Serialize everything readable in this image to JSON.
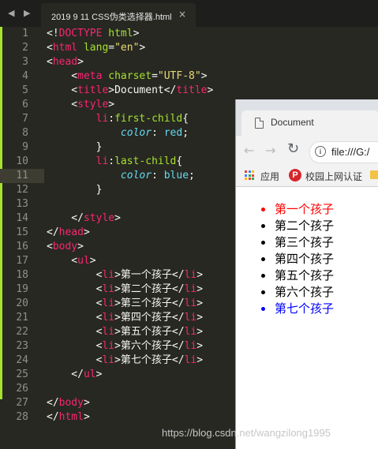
{
  "editor": {
    "tab_title": "2019 9 11 CSS伪类选择器.html",
    "nav_arrows": "◀ ▶",
    "close_glyph": "×",
    "active_line": 11
  },
  "code_lines": [
    {
      "n": "1",
      "tokens": [
        [
          "tx",
          "<!"
        ],
        [
          "tg",
          "DOCTYPE"
        ],
        [
          "tx",
          " "
        ],
        [
          "at",
          "html"
        ],
        [
          "tx",
          ">"
        ]
      ]
    },
    {
      "n": "2",
      "tokens": [
        [
          "tx",
          "<"
        ],
        [
          "tg",
          "html"
        ],
        [
          "tx",
          " "
        ],
        [
          "at",
          "lang"
        ],
        [
          "tx",
          "="
        ],
        [
          "st",
          "\"en\""
        ],
        [
          "tx",
          ">"
        ]
      ]
    },
    {
      "n": "3",
      "tokens": [
        [
          "tx",
          "<"
        ],
        [
          "tg",
          "head"
        ],
        [
          "tx",
          ">"
        ]
      ]
    },
    {
      "n": "4",
      "tokens": [
        [
          "tx",
          "    <"
        ],
        [
          "tg",
          "meta"
        ],
        [
          "tx",
          " "
        ],
        [
          "at",
          "charset"
        ],
        [
          "tx",
          "="
        ],
        [
          "st",
          "\"UTF-8\""
        ],
        [
          "tx",
          ">"
        ]
      ]
    },
    {
      "n": "5",
      "tokens": [
        [
          "tx",
          "    <"
        ],
        [
          "tg",
          "title"
        ],
        [
          "tx",
          ">Document</"
        ],
        [
          "tg",
          "title"
        ],
        [
          "tx",
          ">"
        ]
      ]
    },
    {
      "n": "6",
      "tokens": [
        [
          "tx",
          "    <"
        ],
        [
          "tg",
          "style"
        ],
        [
          "tx",
          ">"
        ]
      ]
    },
    {
      "n": "7",
      "tokens": [
        [
          "tx",
          "        "
        ],
        [
          "tg",
          "li"
        ],
        [
          "tx",
          ":"
        ],
        [
          "at",
          "first-child"
        ],
        [
          "tx",
          "{"
        ]
      ]
    },
    {
      "n": "8",
      "tokens": [
        [
          "tx",
          "            "
        ],
        [
          "kw",
          "color"
        ],
        [
          "tx",
          ": "
        ],
        [
          "vl",
          "red"
        ],
        [
          "tx",
          ";"
        ]
      ]
    },
    {
      "n": "9",
      "tokens": [
        [
          "tx",
          "        }"
        ]
      ]
    },
    {
      "n": "10",
      "tokens": [
        [
          "tx",
          "        "
        ],
        [
          "tg",
          "li"
        ],
        [
          "tx",
          ":"
        ],
        [
          "at",
          "last-child"
        ],
        [
          "tx",
          "{"
        ]
      ]
    },
    {
      "n": "11",
      "tokens": [
        [
          "tx",
          "            "
        ],
        [
          "kw",
          "color"
        ],
        [
          "tx",
          ": "
        ],
        [
          "vl",
          "blue"
        ],
        [
          "tx",
          ";"
        ]
      ]
    },
    {
      "n": "12",
      "tokens": [
        [
          "tx",
          "        }"
        ]
      ]
    },
    {
      "n": "13",
      "tokens": []
    },
    {
      "n": "14",
      "tokens": [
        [
          "tx",
          "    </"
        ],
        [
          "tg",
          "style"
        ],
        [
          "tx",
          ">"
        ]
      ]
    },
    {
      "n": "15",
      "tokens": [
        [
          "tx",
          "</"
        ],
        [
          "tg",
          "head"
        ],
        [
          "tx",
          ">"
        ]
      ]
    },
    {
      "n": "16",
      "tokens": [
        [
          "tx",
          "<"
        ],
        [
          "tg",
          "body"
        ],
        [
          "tx",
          ">"
        ]
      ]
    },
    {
      "n": "17",
      "tokens": [
        [
          "tx",
          "    <"
        ],
        [
          "tg",
          "ul"
        ],
        [
          "tx",
          ">"
        ]
      ]
    },
    {
      "n": "18",
      "tokens": [
        [
          "tx",
          "        <"
        ],
        [
          "tg",
          "li"
        ],
        [
          "tx",
          ">第一个孩子</"
        ],
        [
          "tg",
          "li"
        ],
        [
          "tx",
          ">"
        ]
      ]
    },
    {
      "n": "19",
      "tokens": [
        [
          "tx",
          "        <"
        ],
        [
          "tg",
          "li"
        ],
        [
          "tx",
          ">第二个孩子</"
        ],
        [
          "tg",
          "li"
        ],
        [
          "tx",
          ">"
        ]
      ]
    },
    {
      "n": "20",
      "tokens": [
        [
          "tx",
          "        <"
        ],
        [
          "tg",
          "li"
        ],
        [
          "tx",
          ">第三个孩子</"
        ],
        [
          "tg",
          "li"
        ],
        [
          "tx",
          ">"
        ]
      ]
    },
    {
      "n": "21",
      "tokens": [
        [
          "tx",
          "        <"
        ],
        [
          "tg",
          "li"
        ],
        [
          "tx",
          ">第四个孩子</"
        ],
        [
          "tg",
          "li"
        ],
        [
          "tx",
          ">"
        ]
      ]
    },
    {
      "n": "22",
      "tokens": [
        [
          "tx",
          "        <"
        ],
        [
          "tg",
          "li"
        ],
        [
          "tx",
          ">第五个孩子</"
        ],
        [
          "tg",
          "li"
        ],
        [
          "tx",
          ">"
        ]
      ]
    },
    {
      "n": "23",
      "tokens": [
        [
          "tx",
          "        <"
        ],
        [
          "tg",
          "li"
        ],
        [
          "tx",
          ">第六个孩子</"
        ],
        [
          "tg",
          "li"
        ],
        [
          "tx",
          ">"
        ]
      ]
    },
    {
      "n": "24",
      "tokens": [
        [
          "tx",
          "        <"
        ],
        [
          "tg",
          "li"
        ],
        [
          "tx",
          ">第七个孩子</"
        ],
        [
          "tg",
          "li"
        ],
        [
          "tx",
          ">"
        ]
      ]
    },
    {
      "n": "25",
      "tokens": [
        [
          "tx",
          "    </"
        ],
        [
          "tg",
          "ul"
        ],
        [
          "tx",
          ">"
        ]
      ]
    },
    {
      "n": "26",
      "tokens": []
    },
    {
      "n": "27",
      "tokens": [
        [
          "tx",
          "</"
        ],
        [
          "tg",
          "body"
        ],
        [
          "tx",
          ">"
        ]
      ]
    },
    {
      "n": "28",
      "tokens": [
        [
          "tx",
          "</"
        ],
        [
          "tg",
          "html"
        ],
        [
          "tx",
          ">"
        ]
      ]
    }
  ],
  "browser": {
    "tab_title": "Document",
    "url": "file:///G:/",
    "info_glyph": "i",
    "back_glyph": "←",
    "forward_glyph": "→",
    "reload_glyph": "↻",
    "bookmarks": {
      "apps": "应用",
      "p_badge": "P",
      "school": "校园上网认证"
    },
    "list_items": [
      "第一个孩子",
      "第二个孩子",
      "第三个孩子",
      "第四个孩子",
      "第五个孩子",
      "第六个孩子",
      "第七个孩子"
    ]
  },
  "colors": {
    "first_child": "#ff0000",
    "last_child": "#0000ff"
  },
  "watermark": "https://blog.csdn.net/wangzilong1995"
}
